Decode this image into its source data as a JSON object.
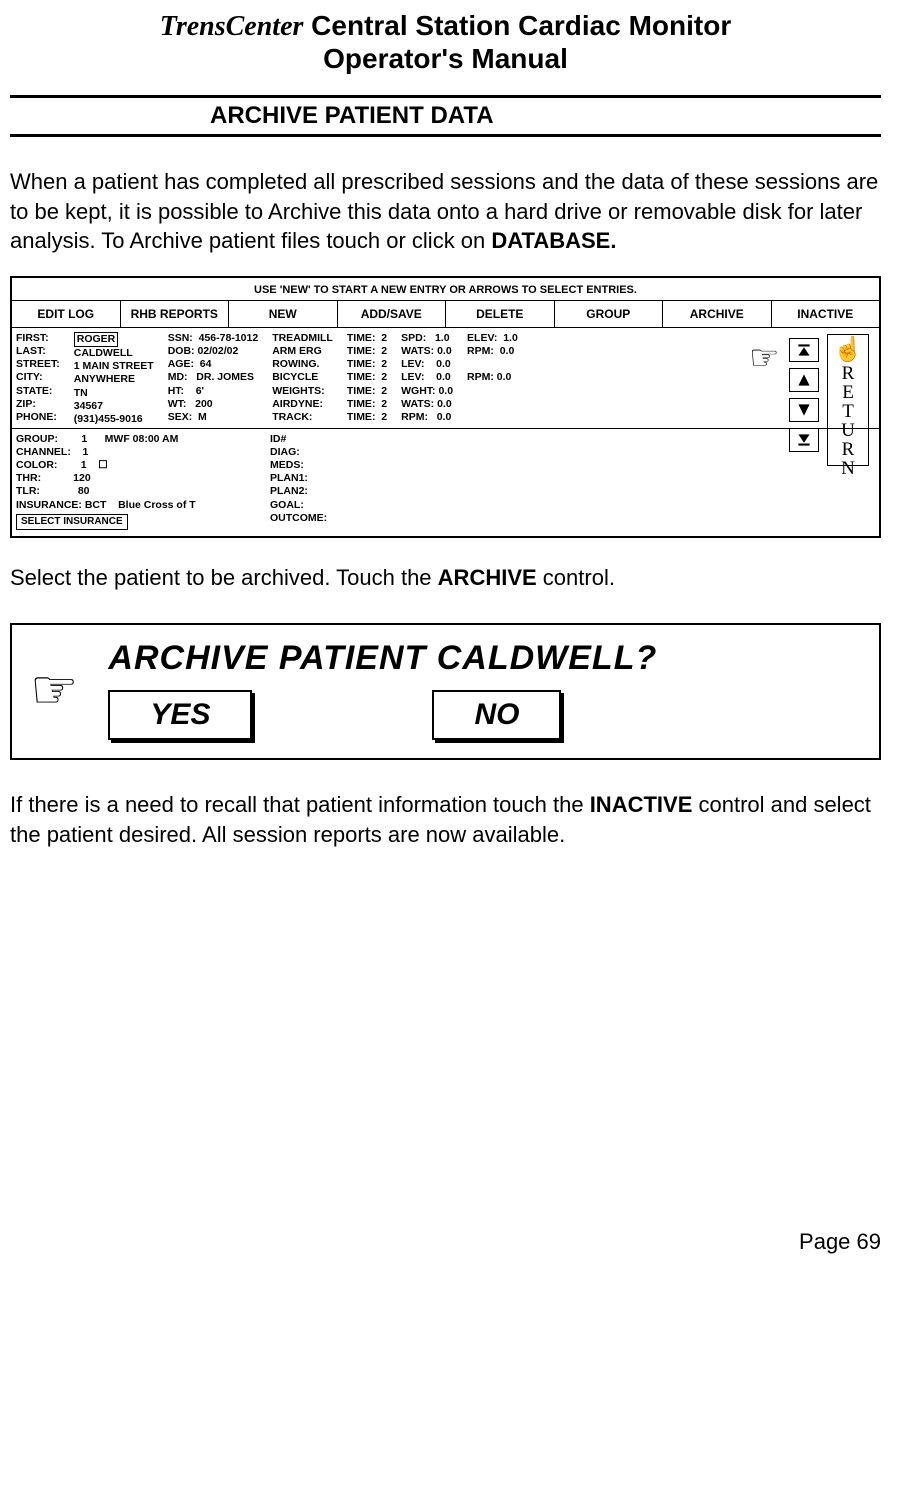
{
  "header": {
    "brand": "TrensCenter",
    "title_rest": " Central Station Cardiac Monitor",
    "subtitle": "Operator's Manual",
    "section": "ARCHIVE PATIENT DATA"
  },
  "para1_a": "When a patient has completed all prescribed sessions and the data of these sessions are to be kept, it is possible to Archive this data onto a hard drive or removable disk for later analysis.  To Archive patient files touch or click on ",
  "para1_b": "DATABASE.",
  "db": {
    "hint": "USE 'NEW' TO START A NEW ENTRY OR ARROWS TO SELECT ENTRIES.",
    "buttons": [
      "EDIT LOG",
      "RHB REPORTS",
      "NEW",
      "ADD/SAVE",
      "DELETE",
      "GROUP",
      "ARCHIVE",
      "INACTIVE"
    ],
    "col1": "FIRST:\nLAST:\nSTREET:\nCITY:\nSTATE:\nZIP:\nPHONE:",
    "col1v": "ROGER\nCALDWELL\n1 MAIN STREET\nANYWHERE\nTN\n34567\n(931)455-9016",
    "col2": "SSN:  456-78-1012\nDOB: 02/02/02\nAGE:  64\nMD:   DR. JOMES\nHT:    6'\nWT:   200\nSEX:  M",
    "col3": "TREADMILL\nARM ERG\nROWING.\nBICYCLE\nWEIGHTS:\nAIRDYNE:\nTRACK:",
    "col4": "TIME:  2\nTIME:  2\nTIME:  2\nTIME:  2\nTIME:  2\nTIME:  2\nTIME:  2",
    "col5": "SPD:   1.0\nWATS: 0.0\nLEV:    0.0\nLEV:    0.0\nWGHT: 0.0\nWATS: 0.0\nRPM:   0.0",
    "col6": "ELEV:  1.0\nRPM:  0.0\n\nRPM: 0.0",
    "lower_l": "GROUP:        1      MWF 08:00 AM\nCHANNEL:    1\nCOLOR:        1    ☐\nTHR:           120\nTLR:             80\nINSURANCE: BCT    Blue Cross of T",
    "lower_r": "ID#\nDIAG:\nMEDS:\nPLAN1:\nPLAN2:\nGOAL:\nOUTCOME:",
    "sel_ins": "SELECT INSURANCE",
    "return": "R\nE\nT\nU\nR\nN"
  },
  "para2_a": "Select the patient to be archived.  Touch the ",
  "para2_b": "ARCHIVE",
  "para2_c": " control.",
  "dialog": {
    "question": "ARCHIVE  PATIENT CALDWELL?",
    "yes": "YES",
    "no": "NO"
  },
  "para3_a": "If there is a need to recall that patient information touch the ",
  "para3_b": "INACTIVE",
  "para3_c": " control and select the patient desired.  All session reports are now available.",
  "page_num": "Page 69"
}
